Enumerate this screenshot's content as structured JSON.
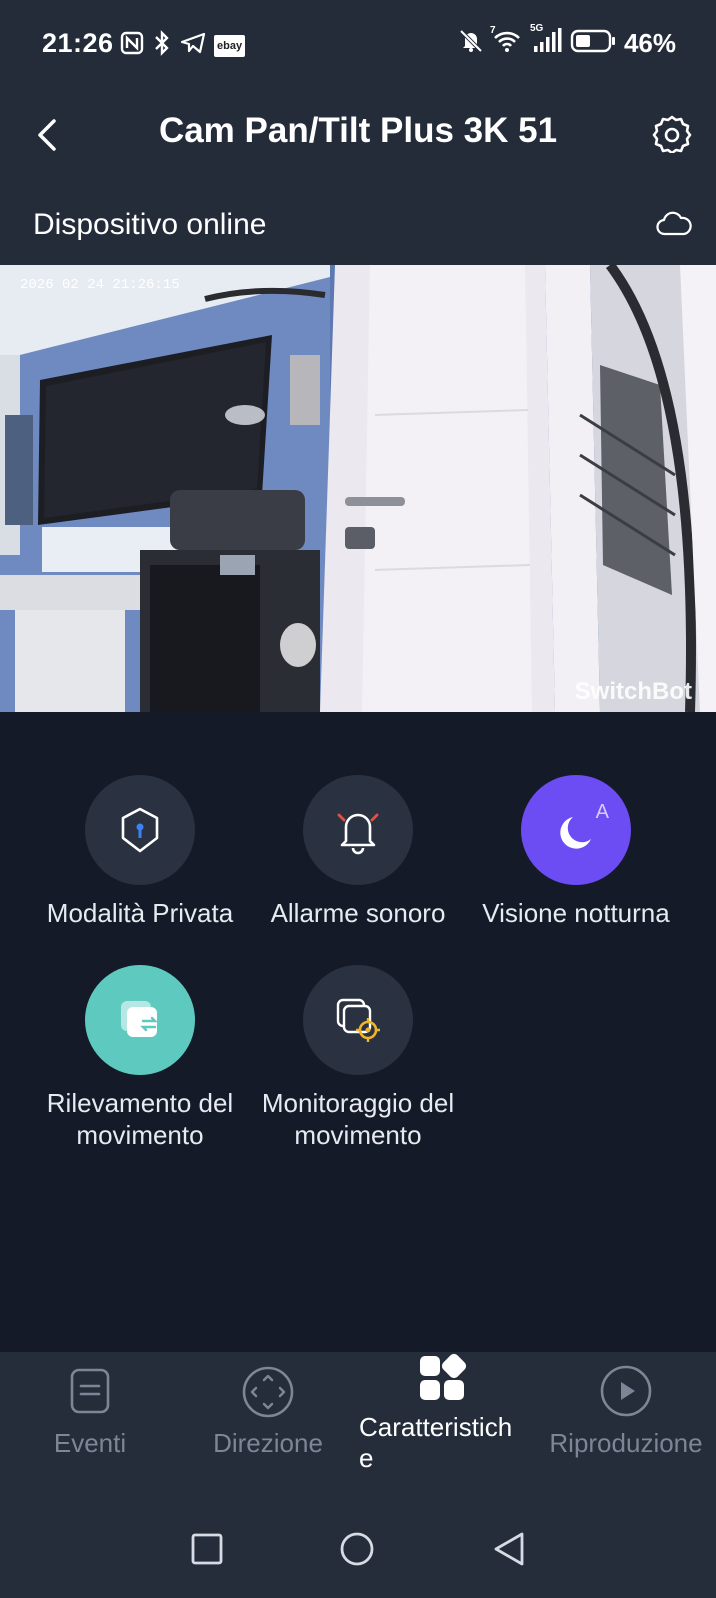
{
  "status_bar": {
    "time": "21:26",
    "notification_icons": [
      "nfc-icon",
      "bluetooth-icon",
      "telegram-icon",
      "ebay-icon"
    ],
    "ebay_label": "ebay",
    "network_label": "5G",
    "wifi_label": "7",
    "battery": "46%",
    "battery_level": 0.46
  },
  "header": {
    "title": "Cam Pan/Tilt Plus 3K 51",
    "back_icon": "chevron-left-icon",
    "settings_icon": "gear-icon"
  },
  "status_row": {
    "text": "Dispositivo online",
    "cloud_icon": "cloud-icon"
  },
  "video": {
    "timestamp": "2026 02 24 21:26:15",
    "watermark": "SwitchBot"
  },
  "features": [
    {
      "label": "Modalità Privata",
      "icon": "shield-icon",
      "active": false
    },
    {
      "label": "Allarme sonoro",
      "icon": "bell-icon",
      "active": false
    },
    {
      "label": "Visione notturna",
      "icon": "moon-icon",
      "badge": "A",
      "active": true
    },
    {
      "label": "Rilevamento del movimento",
      "icon": "motion-detect-icon",
      "active": true
    },
    {
      "label": "Monitoraggio del movimento",
      "icon": "motion-tracking-icon",
      "active": false
    }
  ],
  "colors": {
    "top_bg": "#242b39",
    "page_bg": "#141a27",
    "feature_bg": "#2a3140",
    "night_vision_active": "#6c4cf3",
    "motion_active": "#5ecabf",
    "alarm_accent": "#e2523f",
    "tracking_accent": "#f0b429"
  },
  "tabs": [
    {
      "label": "Eventi",
      "icon": "events-icon",
      "active": false
    },
    {
      "label": "Direzione",
      "icon": "direction-icon",
      "active": false
    },
    {
      "label": "Caratteristich\ne",
      "icon": "features-icon",
      "active": true
    },
    {
      "label": "Riproduzione",
      "icon": "play-icon",
      "active": false
    }
  ],
  "system_nav": [
    "recents-square-icon",
    "home-circle-icon",
    "back-triangle-icon"
  ]
}
